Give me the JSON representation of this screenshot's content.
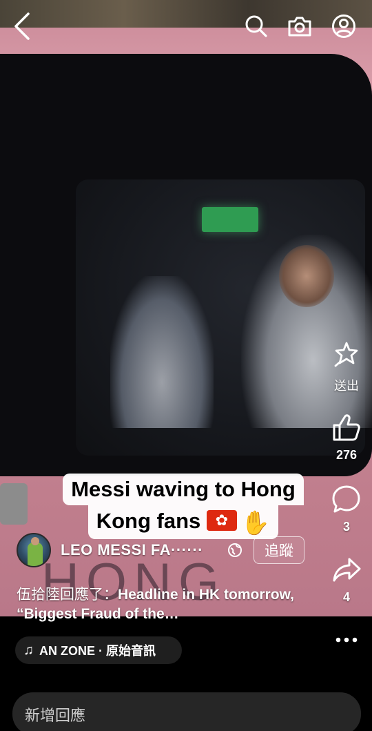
{
  "topbar": {
    "back_icon": "back-arrow-icon",
    "search_icon": "search-icon",
    "camera_icon": "camera-icon",
    "profile_icon": "profile-icon"
  },
  "actions": {
    "share": {
      "icon": "sparkle-share-icon",
      "label": "送出"
    },
    "like": {
      "icon": "thumbs-up-icon",
      "count": "276"
    },
    "comment": {
      "icon": "comment-bubble-icon",
      "count": "3"
    },
    "forward": {
      "icon": "forward-arrow-icon",
      "count": "4"
    }
  },
  "caption": {
    "line1": "Messi waving to Hong",
    "line2": "Kong fans",
    "emoji": [
      "hong-kong-flag",
      "waving-hand"
    ]
  },
  "author": {
    "name": "LEO MESSI FA······",
    "follow_label": "追蹤"
  },
  "description": {
    "prefix": "伍拾陸回應了：",
    "text": "Headline in HK tomorrow, “Biggest Fraud of the…"
  },
  "music": {
    "icon": "music-note-icon",
    "label": "AN ZONE · 原始音訊"
  },
  "comment_input": {
    "placeholder": "新增回應"
  },
  "video_background_text": "HONG"
}
